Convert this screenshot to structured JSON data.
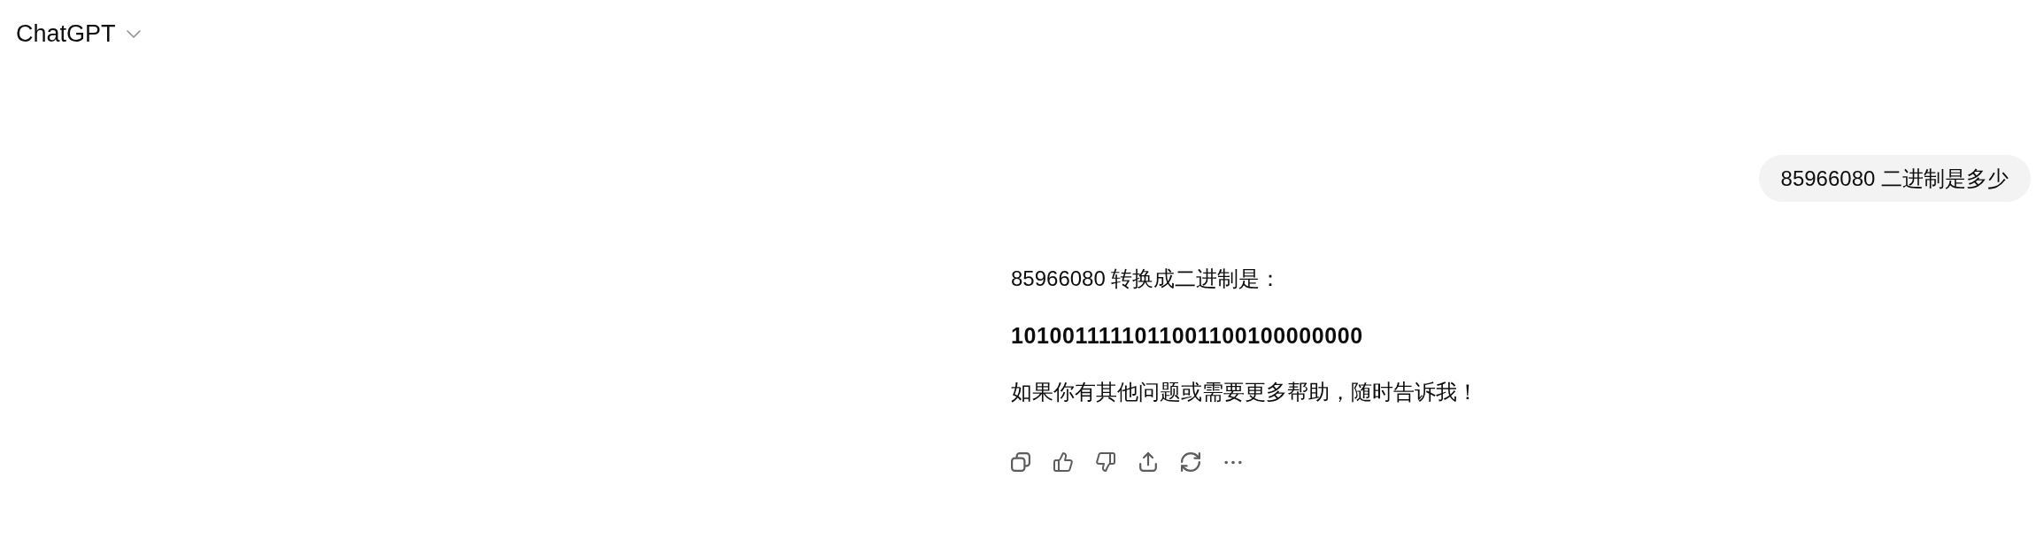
{
  "header": {
    "title": "ChatGPT"
  },
  "messages": [
    {
      "kind": "user",
      "text": "85966080 二进制是多少"
    },
    {
      "kind": "assistant",
      "paragraphs": [
        {
          "kind": "plain",
          "text": "85966080 转换成二进制是："
        },
        {
          "kind": "strong",
          "text": "1010011111011001100100000000"
        },
        {
          "kind": "plain",
          "text": "如果你有其他问题或需要更多帮助，随时告诉我！"
        }
      ],
      "actions": [
        {
          "kind": "copy"
        },
        {
          "kind": "like"
        },
        {
          "kind": "dislike"
        },
        {
          "kind": "share"
        },
        {
          "kind": "regenerate"
        },
        {
          "kind": "more"
        }
      ]
    }
  ]
}
